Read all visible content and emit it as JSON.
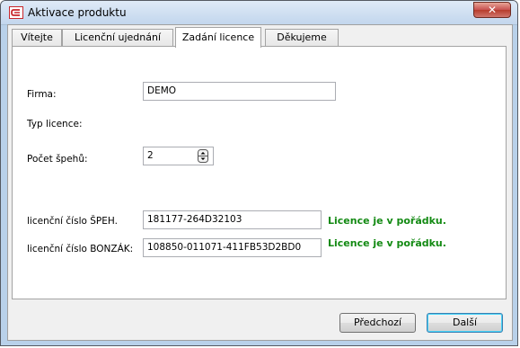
{
  "window": {
    "title": "Aktivace produktu",
    "close_label": "✕"
  },
  "tabs": [
    {
      "label": "Vítejte",
      "active": false
    },
    {
      "label": "Licenční ujednání",
      "active": false
    },
    {
      "label": "Zadání licence",
      "active": true
    },
    {
      "label": "Děkujeme",
      "active": false
    }
  ],
  "form": {
    "firma_label": "Firma:",
    "firma_value": "DEMO",
    "typ_licence_label": "Typ licence:",
    "pocet_spehu_label": "Počet špehů:",
    "pocet_spehu_value": "2",
    "lic_speh_label": "licenční číslo ŠPEH.",
    "lic_speh_value": "181177-264D32103",
    "lic_speh_status": "Licence je v pořádku.",
    "lic_bonzak_label": "licenční číslo BONZÁK:",
    "lic_bonzak_value": "108850-011071-411FB53D2BD0",
    "lic_bonzak_status": "Licence je v pořádku."
  },
  "buttons": {
    "prev": "Předchozí",
    "next": "Další"
  },
  "colors": {
    "status_ok": "#138a13",
    "titlebar": "#c2d6ed"
  }
}
